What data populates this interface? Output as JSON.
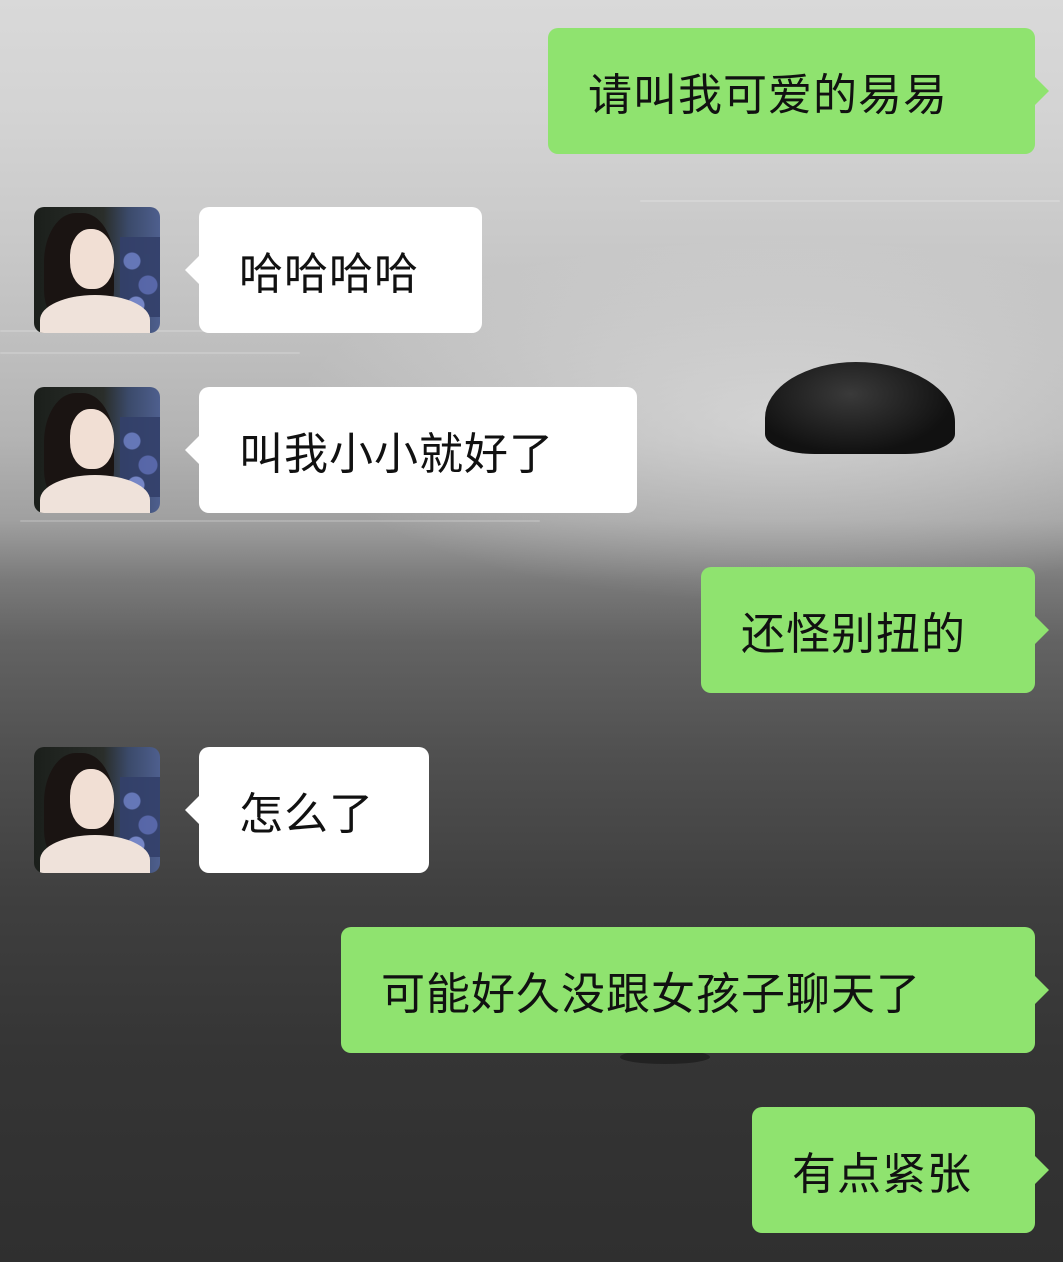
{
  "chat": {
    "messages": [
      {
        "sender": "me",
        "text": "请叫我可爱的易易"
      },
      {
        "sender": "them",
        "text": "哈哈哈哈"
      },
      {
        "sender": "them",
        "text": "叫我小小就好了"
      },
      {
        "sender": "me",
        "text": "还怪别扭的"
      },
      {
        "sender": "them",
        "text": "怎么了"
      },
      {
        "sender": "me",
        "text": "可能好久没跟女孩子聊天了"
      },
      {
        "sender": "me",
        "text": "有点紧张"
      }
    ]
  },
  "colors": {
    "my_bubble": "#8fe36f",
    "their_bubble": "#ffffff"
  },
  "icons": {
    "contact_avatar": "woman-portrait-avatar"
  }
}
